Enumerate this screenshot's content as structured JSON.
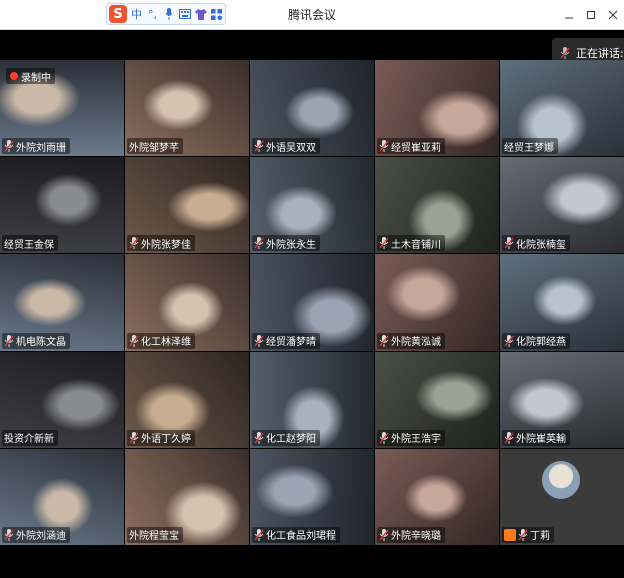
{
  "app": {
    "title": "腾讯会议",
    "ime_logo": "S",
    "ime_buttons": [
      "中",
      "°,",
      "mic-icon",
      "keyboard-icon",
      "shirt-icon",
      "grid-icon"
    ]
  },
  "window_controls": [
    "minimize-icon",
    "maximize-icon",
    "close-icon"
  ],
  "speaking": {
    "label": "正在讲话:"
  },
  "recording": {
    "label": "录制中"
  },
  "participants": [
    {
      "name": "外院刘雨珊",
      "mic": true
    },
    {
      "name": "外院邹梦芊",
      "mic": false
    },
    {
      "name": "外语吴双双",
      "mic": true
    },
    {
      "name": "经贸崔亚莉",
      "mic": true
    },
    {
      "name": "经贸王梦娜",
      "mic": false
    },
    {
      "name": "经贸王金保",
      "mic": false
    },
    {
      "name": "外院张梦佳",
      "mic": true
    },
    {
      "name": "外院张永生",
      "mic": true
    },
    {
      "name": "土木音铺川",
      "mic": true
    },
    {
      "name": "化院张楠玺",
      "mic": true
    },
    {
      "name": "机电陈文晶",
      "mic": true
    },
    {
      "name": "化工林泽维",
      "mic": true
    },
    {
      "name": "经贸潘梦晴",
      "mic": true
    },
    {
      "name": "外院黄泓诚",
      "mic": true
    },
    {
      "name": "化院郭经燕",
      "mic": true
    },
    {
      "name": "投资介新新",
      "mic": false
    },
    {
      "name": "外语丁久婷",
      "mic": true
    },
    {
      "name": "化工赵梦阳",
      "mic": true
    },
    {
      "name": "外院王浩宇",
      "mic": true
    },
    {
      "name": "外院崔英輸",
      "mic": true
    },
    {
      "name": "外院刘涵迪",
      "mic": true
    },
    {
      "name": "外院程莹宝",
      "mic": false
    },
    {
      "name": "化工食品刘珺程",
      "mic": true
    },
    {
      "name": "外院辛晓璐",
      "mic": true
    },
    {
      "name": "丁莉",
      "mic": true,
      "host": true
    }
  ],
  "colors": {
    "titlebar": "#ffffff",
    "background": "#000000",
    "mic_muted": "#e23b3b",
    "host_badge": "#ff7a1a"
  }
}
